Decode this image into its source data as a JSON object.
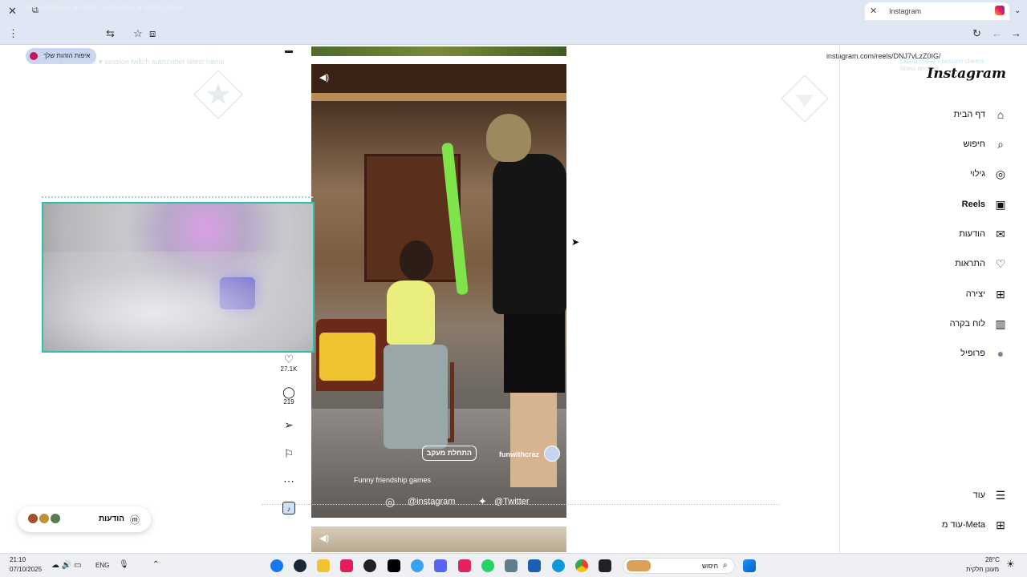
{
  "browser": {
    "tab_title": "Instagram",
    "url": "instagram.com/reels/DNJ7vLzZ0IG/",
    "profile_pill": "איפות הזהות שלך",
    "watermark_top": "Latest Follower ♥ twitch_subscriber ♥ latest_donor",
    "watermark_left": "Latest Subscriber ♥ session twitch subscriber latest name",
    "watermark_right": "Latest cheer · session cheers · latest amount"
  },
  "sidebar": {
    "logo": "Instagram",
    "items": [
      {
        "label": "דף הבית",
        "icon": "home-icon",
        "glyph": "⌂"
      },
      {
        "label": "חיפוש",
        "icon": "search-icon",
        "glyph": "⌕"
      },
      {
        "label": "גילוי",
        "icon": "explore-icon",
        "glyph": "◎"
      },
      {
        "label": "Reels",
        "icon": "reels-icon",
        "glyph": "▣"
      },
      {
        "label": "הודעות",
        "icon": "messenger-icon",
        "glyph": "✉"
      },
      {
        "label": "התראות",
        "icon": "heart-icon",
        "glyph": "♡"
      },
      {
        "label": "יצירה",
        "icon": "plus-square-icon",
        "glyph": "⊞"
      },
      {
        "label": "לוח בקרה",
        "icon": "dashboard-icon",
        "glyph": "▥"
      },
      {
        "label": "פרופיל",
        "icon": "profile-avatar",
        "glyph": "●"
      }
    ],
    "more_label": "עוד",
    "meta_label": "עוד מ-Meta"
  },
  "reel": {
    "username": "funwithcraz",
    "follow_label": "התחלת מעקב",
    "caption": "Funny friendship games",
    "social_instagram": "@instagram",
    "social_twitter": "@Twitter",
    "likes": "27.1K",
    "comments": "219"
  },
  "messages_pill": {
    "label": "הודעות"
  },
  "taskbar": {
    "time": "21:10",
    "date": "07/10/2025",
    "lang": "ENG",
    "search_placeholder": "חיפוש",
    "weather_temp": "28°C",
    "weather_desc": "מעונן חלקית"
  },
  "colors": {
    "chrome_bg": "#dfe7f5",
    "float_border": "#2bc0b0",
    "instagram_gradient_start": "#f9a825",
    "instagram_gradient_end": "#7b1fa2"
  }
}
